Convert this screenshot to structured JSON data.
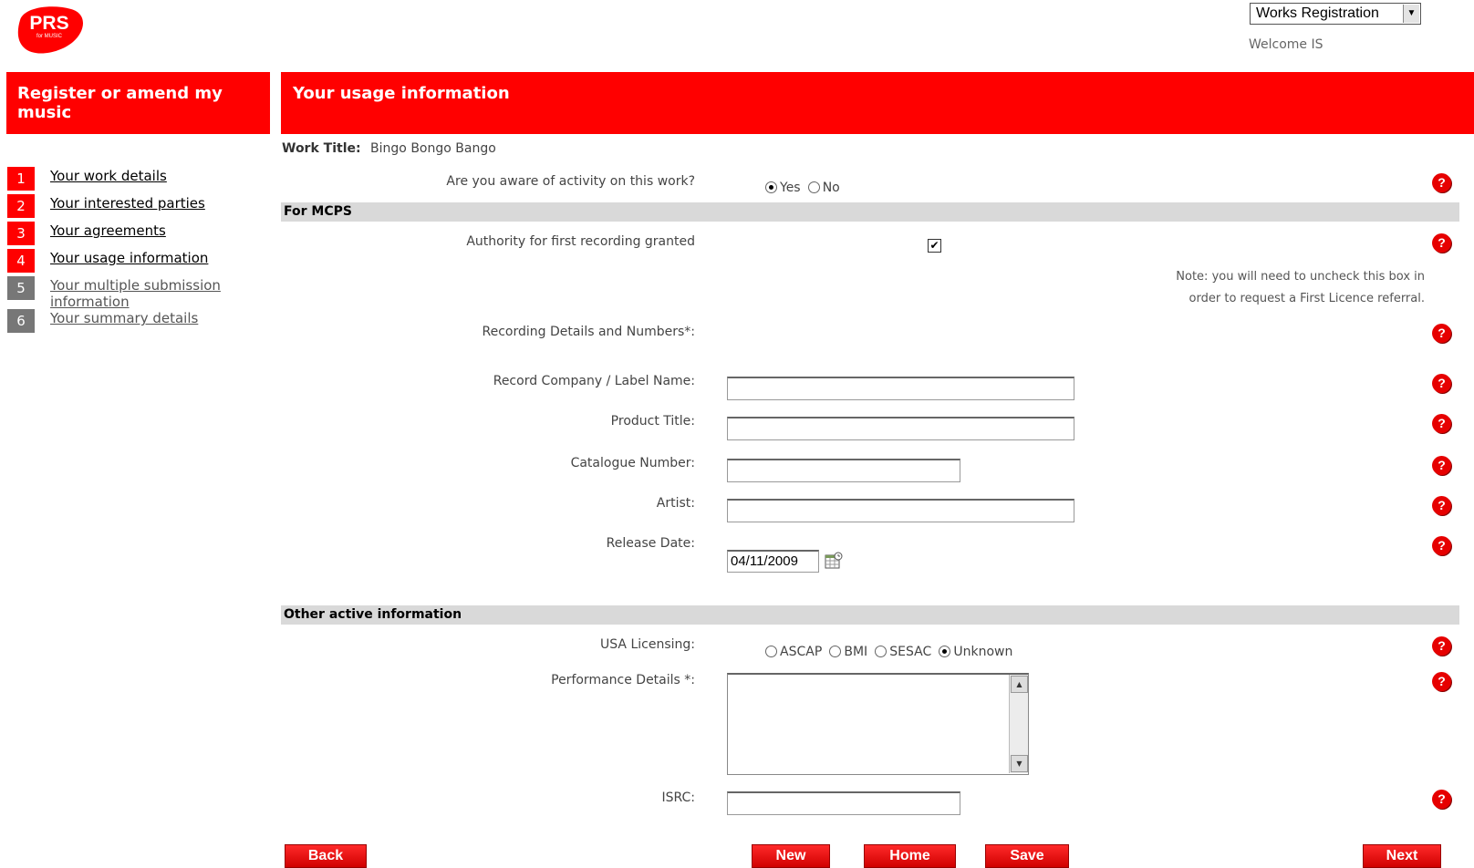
{
  "logo": {
    "text": "PRS",
    "subtext": "for MUSIC"
  },
  "header": {
    "nav_select_value": "Works Registration",
    "welcome": "Welcome IS",
    "left_title": "Register or amend my music",
    "main_title": "Your usage information"
  },
  "sidebar": {
    "steps": [
      {
        "num": "1",
        "label": "Your work details",
        "active": true
      },
      {
        "num": "2",
        "label": "Your interested parties",
        "active": true
      },
      {
        "num": "3",
        "label": "Your agreements",
        "active": true
      },
      {
        "num": "4",
        "label": "Your usage information",
        "active": true
      },
      {
        "num": "5",
        "label": "Your multiple submission information",
        "active": false
      },
      {
        "num": "6",
        "label": "Your summary details",
        "active": false
      }
    ]
  },
  "form": {
    "work_title_label": "Work Title:",
    "work_title_value": "Bingo Bongo Bango",
    "activity_question": "Are you aware of activity on this work?",
    "activity_options": [
      "Yes",
      "No"
    ],
    "activity_selected": "Yes",
    "mcps_section": "For MCPS",
    "authority_label": "Authority for first recording granted",
    "authority_checked": true,
    "note_line1": "Note: you will need to uncheck this box in",
    "note_line2": "order to request a First Licence referral.",
    "recording_details_label": "Recording Details and Numbers*:",
    "record_company_label": "Record Company / Label Name:",
    "record_company_value": "",
    "product_title_label": "Product Title:",
    "product_title_value": "",
    "catalogue_label": "Catalogue Number:",
    "catalogue_value": "",
    "artist_label": "Artist:",
    "artist_value": "",
    "release_date_label": "Release Date:",
    "release_date_value": "04/11/2009",
    "other_section": "Other active information",
    "usa_label": "USA Licensing:",
    "usa_options": [
      "ASCAP",
      "BMI",
      "SESAC",
      "Unknown"
    ],
    "usa_selected": "Unknown",
    "performance_label": "Performance Details *:",
    "performance_value": "",
    "isrc_label": "ISRC:",
    "isrc_value": "",
    "help_glyph": "?"
  },
  "buttons": {
    "back": "Back",
    "new": "New",
    "home": "Home",
    "save": "Save",
    "next": "Next"
  },
  "colors": {
    "brand_red": "#ff0000",
    "section_grey": "#d9d9d9",
    "step_inactive": "#777777"
  }
}
